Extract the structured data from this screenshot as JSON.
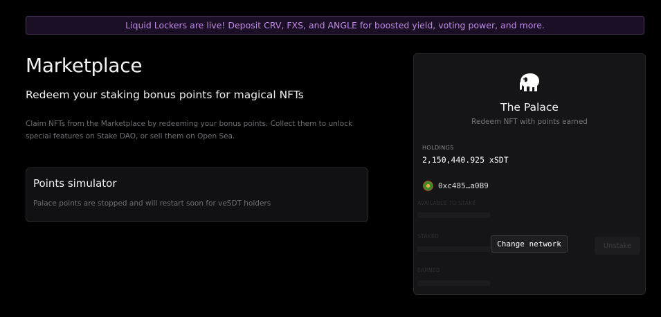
{
  "banner": {
    "text": "Liquid Lockers are live! Deposit CRV, FXS, and ANGLE for boosted yield, voting power, and more."
  },
  "main": {
    "title": "Marketplace",
    "subtitle": "Redeem your staking bonus points for magical NFTs",
    "description": "Claim NFTs from the Marketplace by redeeming your bonus points. Collect them to unlock special features on Stake DAO, or sell them on Open Sea."
  },
  "simulator": {
    "title": "Points simulator",
    "text": "Palace points are stopped and will restart soon for veSDT holders"
  },
  "palace": {
    "icon": "elephant-icon",
    "name": "The Palace",
    "subtitle": "Redeem NFT with points earned",
    "holdings_label": "HOLDINGS",
    "holdings_value": "2,150,440.925 xSDT",
    "address": "0xc485…a0B9",
    "faded": {
      "available_label": "AVAILABLE TO STAKE",
      "staked_label": "STAKED",
      "earned_label": "EARNED"
    },
    "unstake_label": "Unstake",
    "change_network_label": "Change network"
  },
  "colors": {
    "background": "#000000",
    "banner_text": "#c08ae8",
    "card_background": "#151518"
  }
}
